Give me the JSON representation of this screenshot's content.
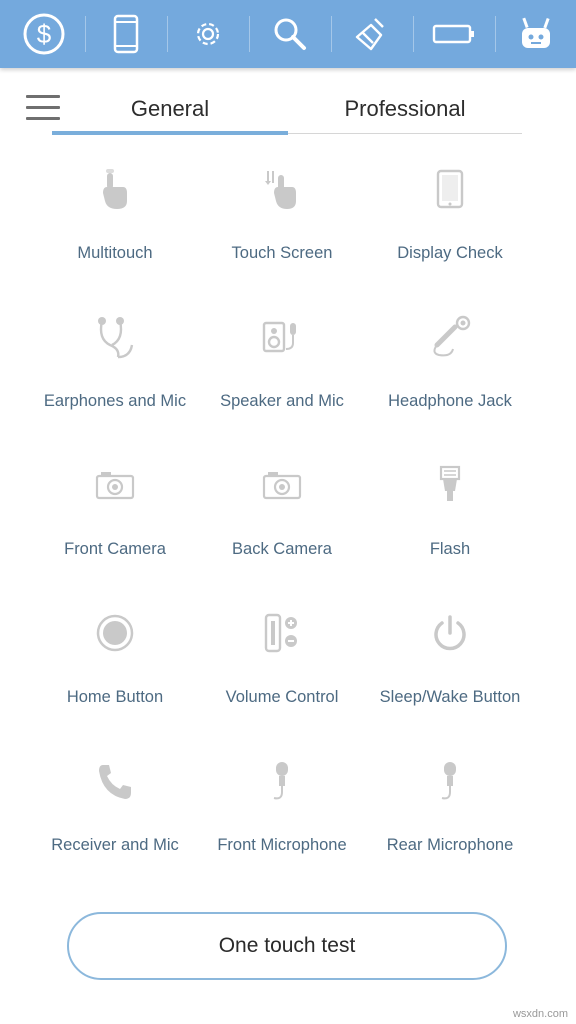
{
  "topbar": {
    "icons": [
      "dollar-icon",
      "phone-icon",
      "settings-icon",
      "search-icon",
      "broom-icon",
      "battery-icon",
      "robot-icon"
    ],
    "color": "#74a9dd"
  },
  "tabs": [
    {
      "label": "General",
      "active": true
    },
    {
      "label": "Professional",
      "active": false
    }
  ],
  "tests": [
    {
      "label": "Multitouch",
      "icon": "finger-tap-icon"
    },
    {
      "label": "Touch Screen",
      "icon": "finger-swipe-icon"
    },
    {
      "label": "Display Check",
      "icon": "display-icon"
    },
    {
      "label": "Earphones and Mic",
      "icon": "earphones-icon"
    },
    {
      "label": "Speaker and Mic",
      "icon": "speaker-icon"
    },
    {
      "label": "Headphone Jack",
      "icon": "headphone-jack-icon"
    },
    {
      "label": "Front Camera",
      "icon": "camera-icon"
    },
    {
      "label": "Back Camera",
      "icon": "camera-icon"
    },
    {
      "label": "Flash",
      "icon": "flash-icon"
    },
    {
      "label": "Home Button",
      "icon": "home-button-icon"
    },
    {
      "label": "Volume Control",
      "icon": "volume-control-icon"
    },
    {
      "label": "Sleep/Wake Button",
      "icon": "power-icon"
    },
    {
      "label": "Receiver and Mic",
      "icon": "phone-receiver-icon"
    },
    {
      "label": "Front Microphone",
      "icon": "microphone-icon"
    },
    {
      "label": "Rear Microphone",
      "icon": "microphone-icon"
    }
  ],
  "one_touch_label": "One touch test",
  "watermark": "wsxdn.com",
  "colors": {
    "accent": "#7aaedb",
    "label": "#4d6a82",
    "icon": "#c8c8c8"
  }
}
